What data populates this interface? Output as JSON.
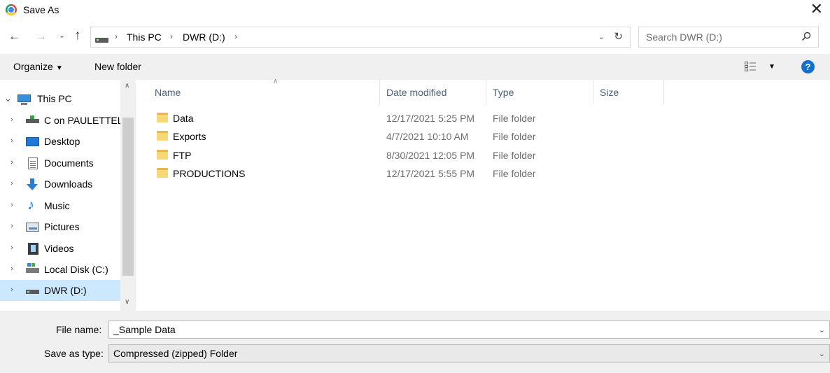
{
  "window": {
    "title": "Save As",
    "close_glyph": "✕"
  },
  "address_bar": {
    "back_glyph": "←",
    "forward_glyph": "→",
    "recent_glyph": "⌄",
    "up_glyph": "↑",
    "breadcrumbs": [
      "This PC",
      "DWR (D:)"
    ],
    "separator": "›",
    "dropdown_glyph": "⌄",
    "refresh_glyph": "↻"
  },
  "search": {
    "placeholder": "Search DWR (D:)"
  },
  "toolbar": {
    "organize_label": "Organize",
    "organize_caret": "▼",
    "new_folder_label": "New folder",
    "view_caret": "▼",
    "help_label": "?"
  },
  "nav_pane": {
    "root": {
      "label": "This PC",
      "expand_glyph": "⌄",
      "icon": "computer-icon"
    },
    "items": [
      {
        "label": "C on PAULETTEL",
        "icon": "network-drive-icon"
      },
      {
        "label": "Desktop",
        "icon": "desktop-icon"
      },
      {
        "label": "Documents",
        "icon": "documents-icon"
      },
      {
        "label": "Downloads",
        "icon": "downloads-icon"
      },
      {
        "label": "Music",
        "icon": "music-icon"
      },
      {
        "label": "Pictures",
        "icon": "pictures-icon"
      },
      {
        "label": "Videos",
        "icon": "videos-icon"
      },
      {
        "label": "Local Disk (C:)",
        "icon": "local-disk-icon"
      },
      {
        "label": "DWR (D:)",
        "icon": "drive-icon",
        "selected": true
      }
    ],
    "expand_glyph": "›",
    "scroll_up_glyph": "∧",
    "scroll_down_glyph": "∨"
  },
  "file_list": {
    "sort_glyph": "∧",
    "columns": {
      "name": "Name",
      "date": "Date modified",
      "type": "Type",
      "size": "Size"
    },
    "rows": [
      {
        "name": "Data",
        "date": "12/17/2021 5:25 PM",
        "type": "File folder"
      },
      {
        "name": "Exports",
        "date": "4/7/2021 10:10 AM",
        "type": "File folder"
      },
      {
        "name": "FTP",
        "date": "8/30/2021 12:05 PM",
        "type": "File folder"
      },
      {
        "name": "PRODUCTIONS",
        "date": "12/17/2021 5:55 PM",
        "type": "File folder"
      }
    ]
  },
  "save_fields": {
    "file_name_label": "File name:",
    "file_name_value": "_Sample Data",
    "save_type_label": "Save as type:",
    "save_type_value": "Compressed (zipped) Folder",
    "dropdown_glyph": "⌄"
  }
}
